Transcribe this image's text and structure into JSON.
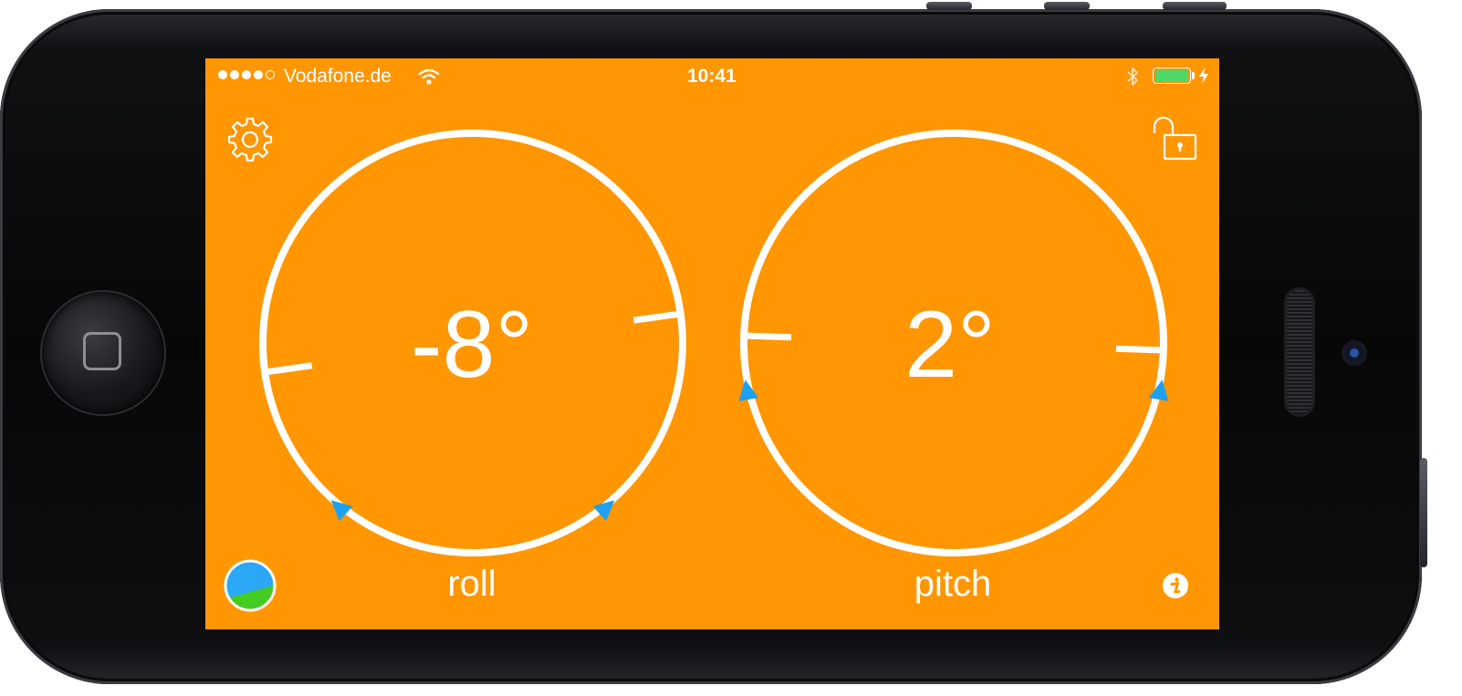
{
  "status_bar": {
    "carrier": "Vodafone.de",
    "time": "10:41",
    "signal_bars_filled": 4,
    "signal_bars_total": 5,
    "battery_level": 1.0
  },
  "gauges": {
    "roll": {
      "value": "-8°",
      "label": "roll",
      "angle_degrees": -8
    },
    "pitch": {
      "value": "2°",
      "label": "pitch",
      "angle_degrees": 2
    }
  },
  "icons": {
    "settings": "gear-icon",
    "lock": "unlock-icon",
    "level_mode": "level-ball-icon",
    "info": "info-icon"
  },
  "colors": {
    "background": "#ff9602",
    "foreground": "#ffffff",
    "marker": "#1ea1f2",
    "sky": "#2aa7f5",
    "ground": "#44cc22"
  }
}
